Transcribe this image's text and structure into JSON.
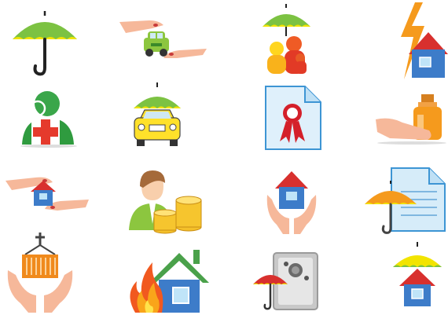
{
  "icons": [
    {
      "row": 1,
      "col": 1,
      "name": "umbrella-icon"
    },
    {
      "row": 1,
      "col": 2,
      "name": "hands-car-icon"
    },
    {
      "row": 1,
      "col": 3,
      "name": "umbrella-family-icon"
    },
    {
      "row": 1,
      "col": 4,
      "name": "lightning-house-icon"
    },
    {
      "row": 2,
      "col": 1,
      "name": "person-medical-cross-icon"
    },
    {
      "row": 2,
      "col": 2,
      "name": "umbrella-taxi-icon"
    },
    {
      "row": 2,
      "col": 3,
      "name": "certificate-ribbon-icon"
    },
    {
      "row": 2,
      "col": 4,
      "name": "hand-medicine-bottle-icon"
    },
    {
      "row": 3,
      "col": 1,
      "name": "hands-house-icon"
    },
    {
      "row": 3,
      "col": 2,
      "name": "person-coins-icon"
    },
    {
      "row": 3,
      "col": 3,
      "name": "hands-holding-house-icon"
    },
    {
      "row": 3,
      "col": 4,
      "name": "umbrella-document-icon"
    },
    {
      "row": 4,
      "col": 1,
      "name": "hands-cargo-icon"
    },
    {
      "row": 4,
      "col": 2,
      "name": "fire-house-icon"
    },
    {
      "row": 4,
      "col": 3,
      "name": "umbrella-safe-icon"
    },
    {
      "row": 4,
      "col": 4,
      "name": "umbrella-house-icon"
    }
  ],
  "colors": {
    "umbrella_green": "#7cc242",
    "umbrella_yellow": "#f2e400",
    "house_blue": "#3d7cc9",
    "roof_red": "#d8302e",
    "cross_red": "#e53a2c",
    "skin": "#f6b89a",
    "orange": "#f59a1d"
  }
}
